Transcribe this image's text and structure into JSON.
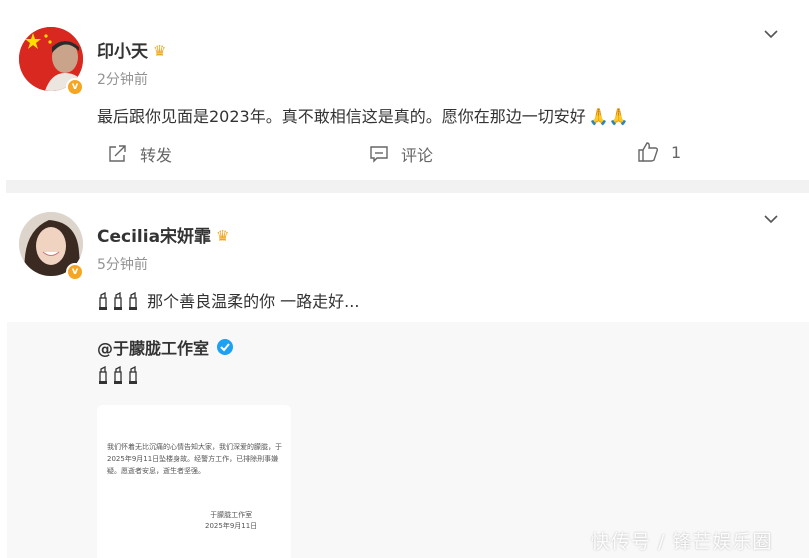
{
  "post1": {
    "author": "印小天",
    "time": "2分钟前",
    "text": "最后跟你见面是2023年。真不敢相信这是真的。愿你在那边一切安好",
    "actions": {
      "repost_label": "转发",
      "comment_label": "评论",
      "like_count": "1"
    }
  },
  "post2": {
    "author": "Cecilia宋妍霏",
    "time": "5分钟前",
    "text": "那个善良温柔的你 一路走好...",
    "repost": {
      "author": "@于朦胧工作室",
      "notice_text": "我们怀着无比沉痛的心情告知大家，我们深爱的朦胧，于2025年9月11日坠楼身故。经警方工作，已排除刑事嫌疑。愿逝者安息，逝生者坚强。",
      "notice_signature": "于朦胧工作室",
      "notice_date": "2025年9月11日"
    }
  },
  "watermark": "快传号 / 锋芒娱乐圈",
  "colors": {
    "verified_orange": "#f5a623",
    "verified_blue": "#1da1f2",
    "muted_text": "#939393"
  }
}
